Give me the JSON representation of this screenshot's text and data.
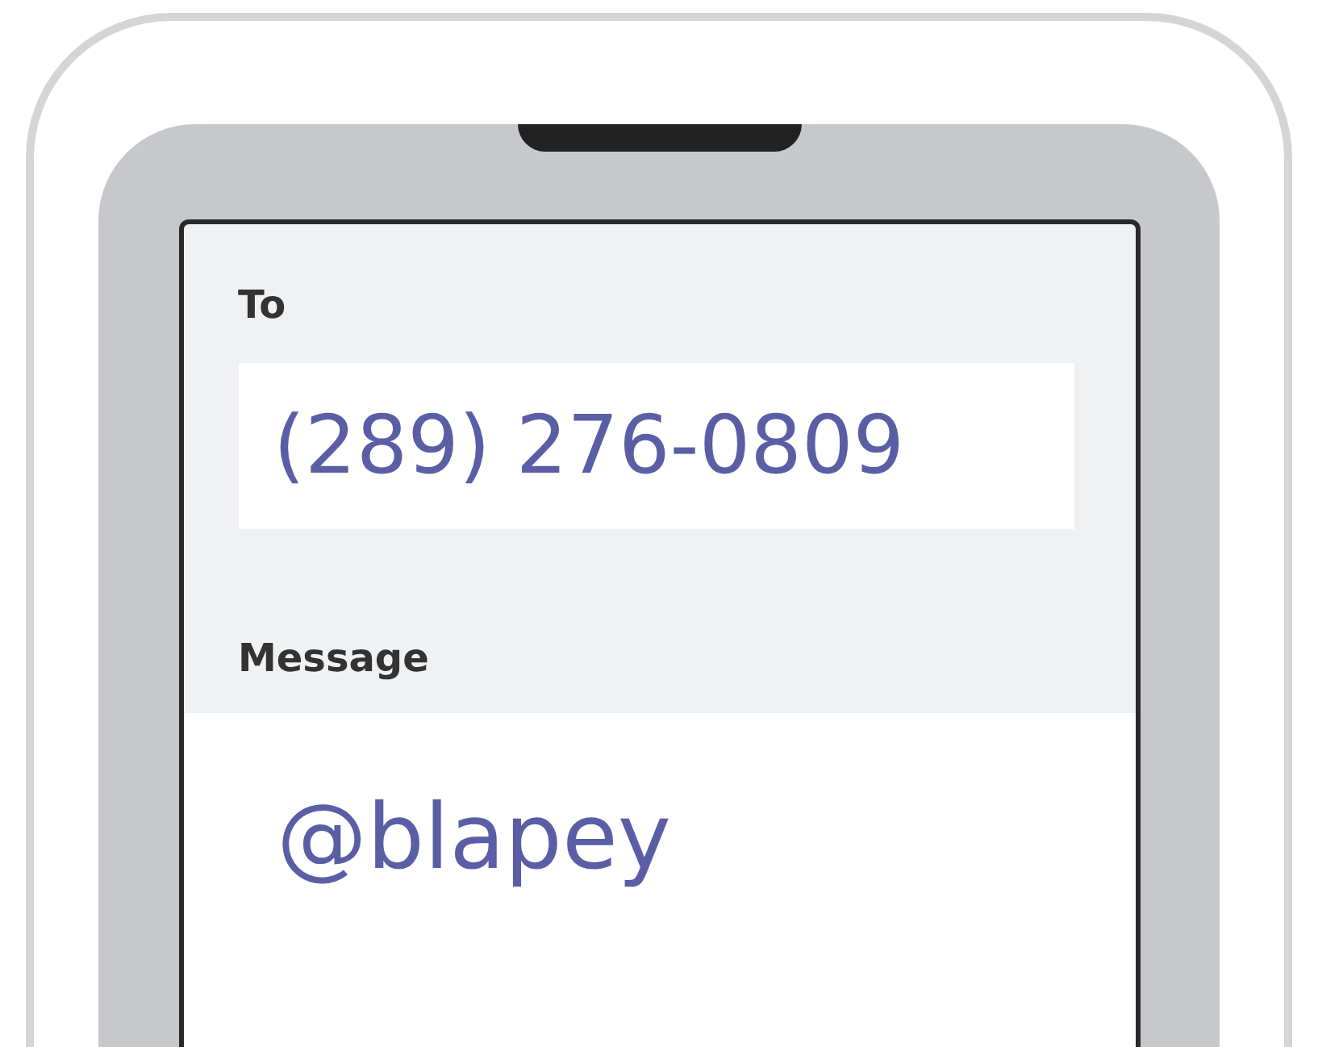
{
  "to": {
    "label": "To",
    "value": "(289) 276-0809"
  },
  "message": {
    "label": "Message",
    "value": "@blapey"
  }
}
